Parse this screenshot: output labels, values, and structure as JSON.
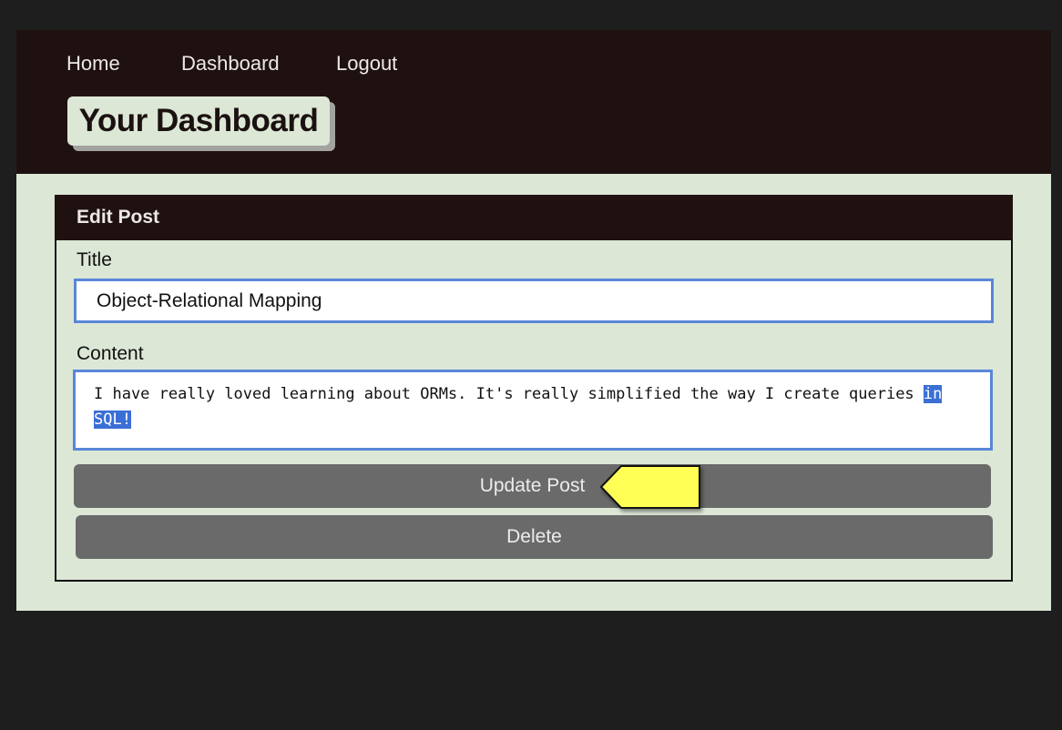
{
  "nav": {
    "home": "Home",
    "dashboard": "Dashboard",
    "logout": "Logout"
  },
  "header": {
    "title": "Your Dashboard"
  },
  "card": {
    "heading": "Edit Post",
    "title_label": "Title",
    "title_value": "Object-Relational Mapping",
    "content_label": "Content",
    "content_unselected": "I have really loved learning about ORMs. It's really simplified the way I create queries ",
    "content_selected_1": "in",
    "content_selected_2": "SQL!",
    "update_button": "Update Post",
    "delete_button": "Delete"
  },
  "annotation": {
    "pointer_icon": "arrow-pointer-icon",
    "pointer_color": "#ffff55"
  },
  "colors": {
    "header_bg": "#201111",
    "page_bg": "#dce7d6",
    "input_border": "#5a86d9",
    "button_bg": "#6a6a6a"
  }
}
